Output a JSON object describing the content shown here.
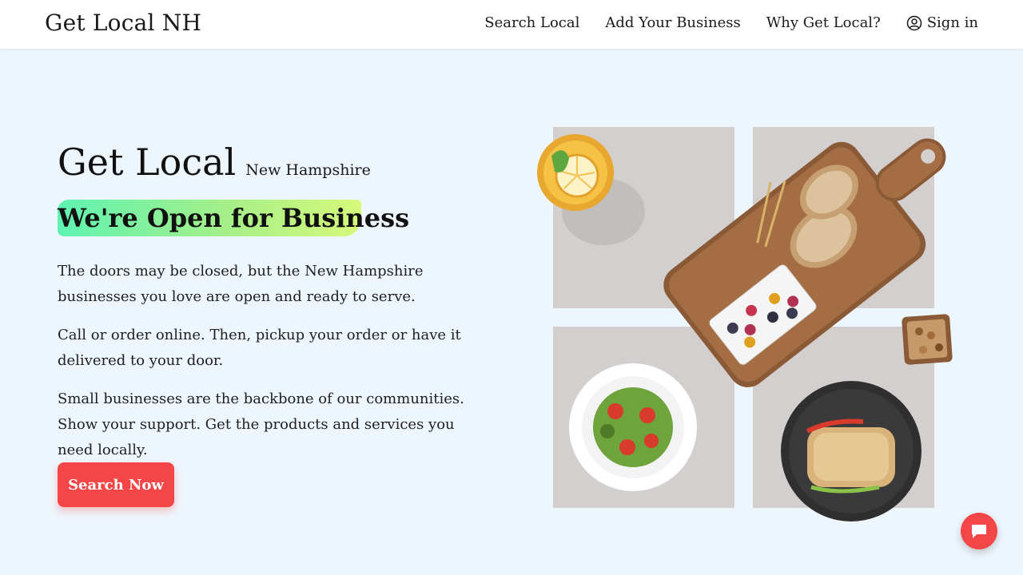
{
  "header": {
    "brand": "Get Local NH",
    "nav": [
      {
        "label": "Search Local"
      },
      {
        "label": "Add Your Business"
      },
      {
        "label": "Why Get Local?"
      },
      {
        "label": "Sign in",
        "icon": "user-circle-icon"
      }
    ]
  },
  "hero": {
    "title": "Get Local",
    "subtitle": "New Hampshire",
    "tagline": "We're Open for Business",
    "paragraphs": [
      "The doors may be closed, but the New Hampshire businesses you love are open and ready to serve.",
      "Call or order online. Then, pickup your order or have it delivered to your door.",
      "Small businesses are the backbone of our communities. Show your support. Get the products and services you need locally."
    ],
    "cta_label": "Search Now"
  },
  "illustration": {
    "items": [
      "lemon-drink",
      "cutting-board-with-bread-and-berries",
      "nuts-bowl",
      "salad-plate",
      "sandwich-plate"
    ]
  },
  "chat": {
    "icon": "chat-icon"
  },
  "colors": {
    "background": "#eef6fd",
    "accent": "#f44646",
    "highlight_start": "#5ef3b2",
    "highlight_end": "#d6f97a",
    "tile": "#d4cfcf"
  }
}
